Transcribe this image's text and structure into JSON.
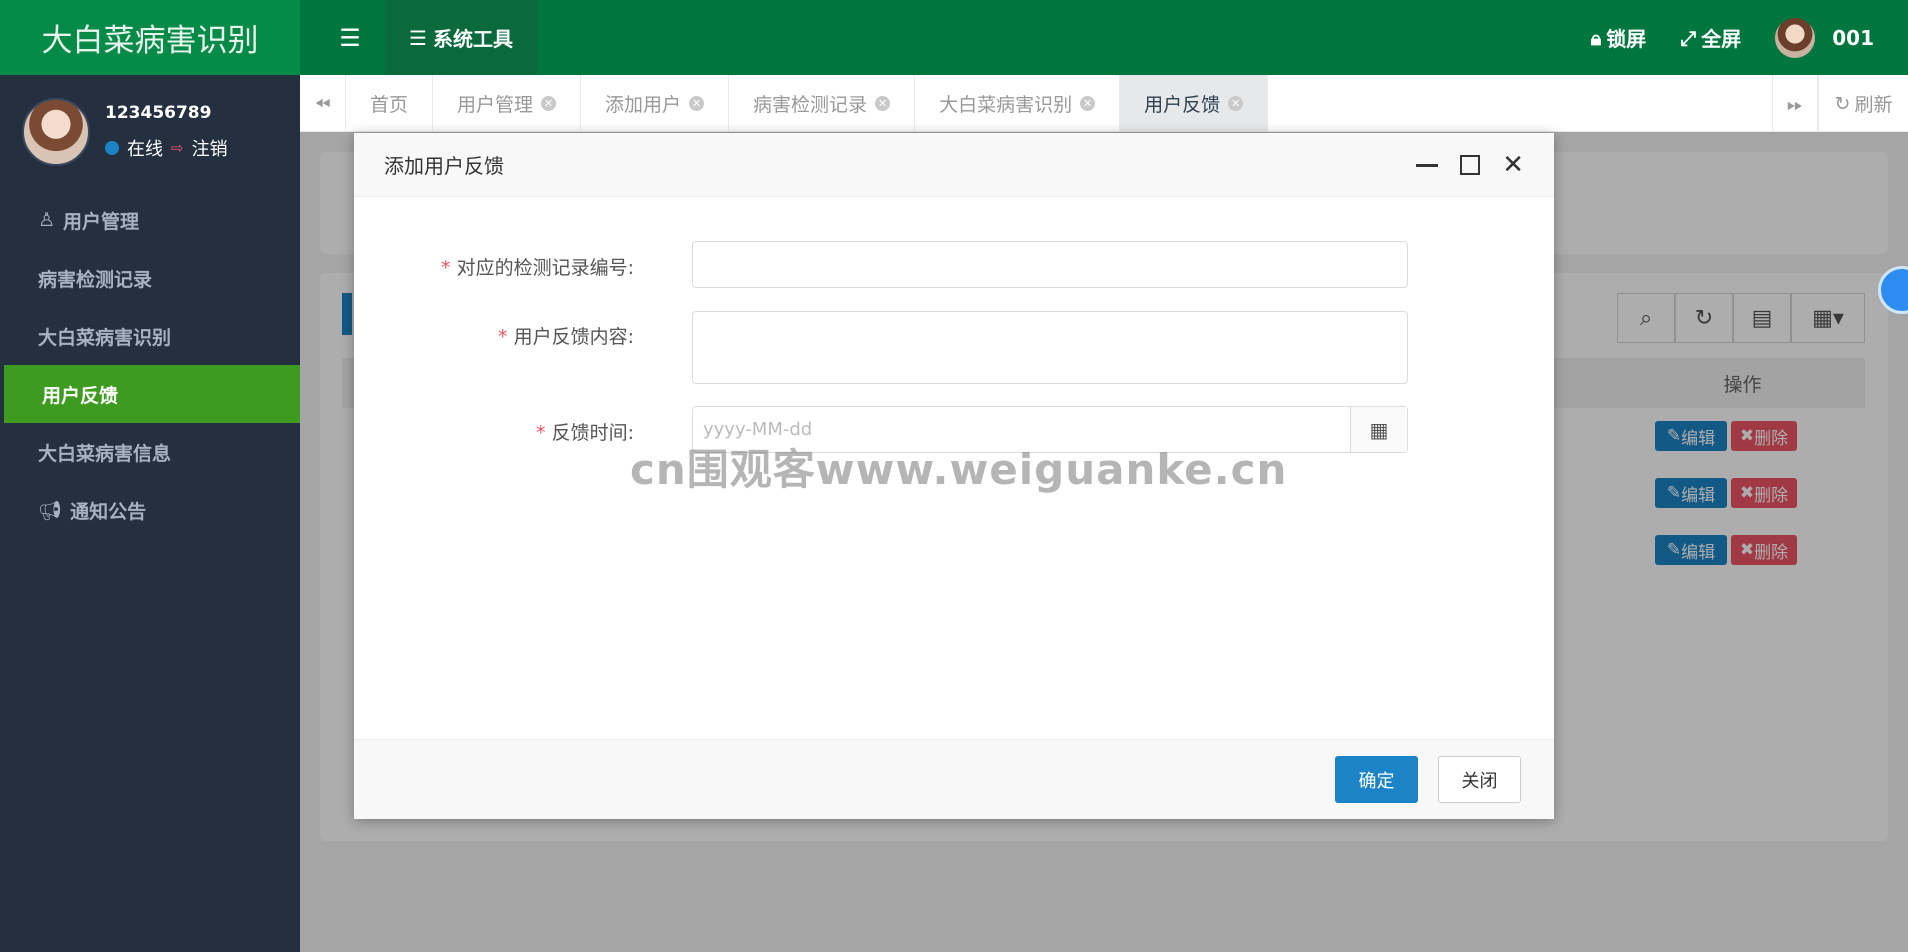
{
  "app": {
    "brand": "大白菜病害识别"
  },
  "header": {
    "systools_label": "系统工具",
    "lock_label": "锁屏",
    "fullscreen_label": "全屏",
    "user_label": "001"
  },
  "user": {
    "name": "123456789",
    "status": "在线",
    "logout": "注销"
  },
  "sidebar": {
    "items": [
      {
        "label": "用户管理",
        "icon": "user-icon"
      },
      {
        "label": "病害检测记录"
      },
      {
        "label": "大白菜病害识别"
      },
      {
        "label": "用户反馈",
        "active": true
      },
      {
        "label": "大白菜病害信息"
      },
      {
        "label": "通知公告",
        "icon": "bullhorn-icon"
      }
    ]
  },
  "tabs": [
    {
      "label": "首页"
    },
    {
      "label": "用户管理"
    },
    {
      "label": "添加用户"
    },
    {
      "label": "病害检测记录"
    },
    {
      "label": "大白菜病害识别"
    },
    {
      "label": "用户反馈",
      "active": true
    }
  ],
  "tabs_right": {
    "refresh_label": "刷新"
  },
  "table": {
    "op_header": "操作",
    "edit_label": "编辑",
    "delete_label": "删除",
    "rows": 3
  },
  "modal": {
    "title": "添加用户反馈",
    "fields": {
      "record_id_label": "对应的检测记录编号:",
      "content_label": "用户反馈内容:",
      "time_label": "反馈时间:",
      "time_placeholder": "yyyy-MM-dd"
    },
    "ok_label": "确定",
    "close_label": "关闭"
  },
  "watermark": "cn围观客www.weiguanke.cn",
  "colors": {
    "header": "#00763f",
    "sidebar": "#243040",
    "active_nav": "#3d9b1f",
    "primary": "#1c84c6",
    "danger": "#ed5565"
  }
}
